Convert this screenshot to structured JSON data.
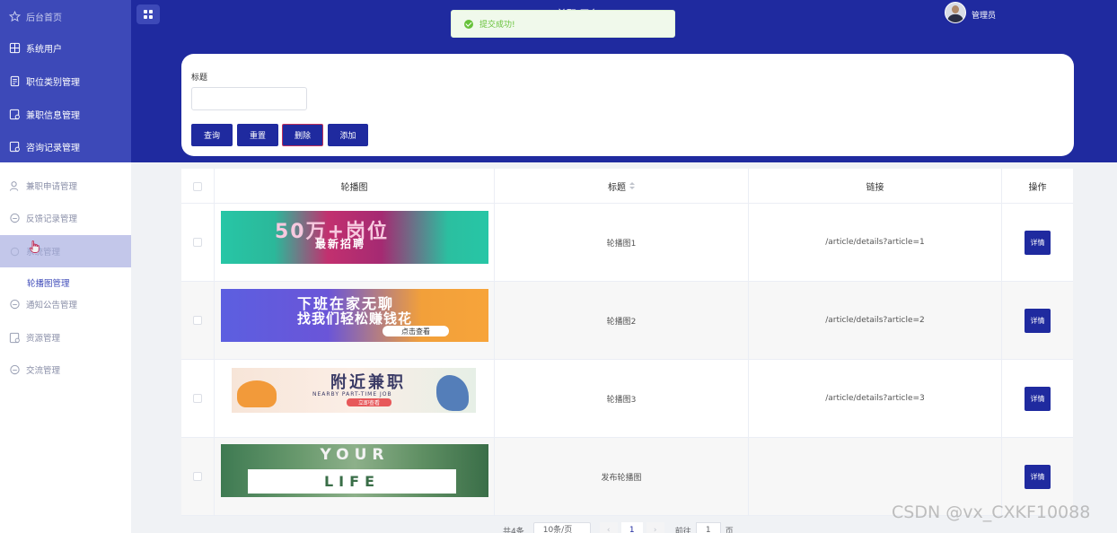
{
  "header": {
    "site_title": "兼职 平台",
    "username": "管理员",
    "toast": "提交成功!"
  },
  "sidebar": {
    "items": [
      {
        "label": "后台首页",
        "icon": "star-icon"
      },
      {
        "label": "系统用户",
        "icon": "grid-icon"
      },
      {
        "label": "职位类别管理",
        "icon": "document-icon"
      },
      {
        "label": "兼职信息管理",
        "icon": "document-icon"
      },
      {
        "label": "咨询记录管理",
        "icon": "document-icon"
      },
      {
        "label": "兼职申请管理",
        "icon": "user-icon"
      },
      {
        "label": "反馈记录管理",
        "icon": "chat-icon"
      },
      {
        "label": "系统管理",
        "icon": "gear-icon"
      },
      {
        "label": "轮播图管理",
        "icon": ""
      },
      {
        "label": "通知公告管理",
        "icon": "chat-icon"
      },
      {
        "label": "资源管理",
        "icon": "document-icon"
      },
      {
        "label": "交流管理",
        "icon": "chat-icon"
      }
    ]
  },
  "search": {
    "title_label": "标题",
    "title_value": "",
    "buttons": {
      "query": "查询",
      "reset": "重置",
      "delete": "删除",
      "add": "添加"
    }
  },
  "table": {
    "headers": {
      "image": "轮播图",
      "title": "标题",
      "link": "链接",
      "action": "操作"
    },
    "rows": [
      {
        "title": "轮播图1",
        "link": "/article/details?article=1",
        "action": "详情",
        "banner": {
          "line1": "50万+岗位",
          "line2": "最新招聘"
        }
      },
      {
        "title": "轮播图2",
        "link": "/article/details?article=2",
        "action": "详情",
        "banner": {
          "line1": "下班在家无聊",
          "line2": "找我们轻松赚钱花",
          "pill": "点击查看"
        }
      },
      {
        "title": "轮播图3",
        "link": "/article/details?article=3",
        "action": "详情",
        "banner": {
          "line1": "附近兼职",
          "line2": "NEARBY PART-TIME JOB",
          "pill": "立即查看"
        }
      },
      {
        "title": "发布轮播图",
        "link": "",
        "action": "详情",
        "banner": {
          "line1": "YOUR",
          "line2": "LIFE"
        }
      }
    ]
  },
  "pagination": {
    "total": "共4条",
    "page_size": "10条/页",
    "prev": "‹",
    "current": "1",
    "next": "›",
    "goto_label": "前往",
    "goto_value": "1",
    "page_unit": "页"
  },
  "watermark": "CSDN @vx_CXKF10088",
  "colors": {
    "primary": "#1f2a9f",
    "sidebar_dark": "#3d49b8",
    "success": "#67c23a"
  }
}
